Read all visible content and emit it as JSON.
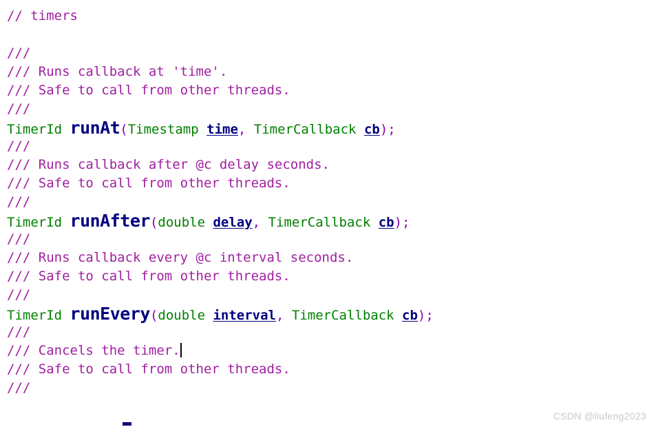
{
  "editor": {
    "language": "cpp",
    "colors": {
      "comment": "#a020a0",
      "type": "#008000",
      "function": "#00007f",
      "punctuation": "#8f00af",
      "parameter": "#00007f",
      "background": "#ffffff",
      "caret": "#000000",
      "watermark": "#c9c9c9"
    },
    "lines": [
      {
        "id": 1,
        "text": "// timers"
      },
      {
        "id": 2,
        "text": ""
      },
      {
        "id": 3,
        "text": "///"
      },
      {
        "id": 4,
        "text": "/// Runs callback at 'time'."
      },
      {
        "id": 5,
        "text": "/// Safe to call from other threads."
      },
      {
        "id": 6,
        "text": "///"
      },
      {
        "id": 7,
        "text": "TimerId runAt(Timestamp time, TimerCallback cb);"
      },
      {
        "id": 8,
        "text": "///"
      },
      {
        "id": 9,
        "text": "/// Runs callback after @c delay seconds."
      },
      {
        "id": 10,
        "text": "/// Safe to call from other threads."
      },
      {
        "id": 11,
        "text": "///"
      },
      {
        "id": 12,
        "text": "TimerId runAfter(double delay, TimerCallback cb);"
      },
      {
        "id": 13,
        "text": "///"
      },
      {
        "id": 14,
        "text": "/// Runs callback every @c interval seconds."
      },
      {
        "id": 15,
        "text": "/// Safe to call from other threads."
      },
      {
        "id": 16,
        "text": "///"
      },
      {
        "id": 17,
        "text": "TimerId runEvery(double interval, TimerCallback cb);"
      },
      {
        "id": 18,
        "text": "///"
      },
      {
        "id": 19,
        "text": "/// Cancels the timer."
      },
      {
        "id": 20,
        "text": "/// Safe to call from other threads."
      },
      {
        "id": 21,
        "text": "///"
      }
    ],
    "tokens": {
      "l1_comment": "// timers",
      "l3_comment": "///",
      "l4_comment": "/// Runs callback at 'time'.",
      "l5_comment": "/// Safe to call from other threads.",
      "l6_comment": "///",
      "l7_type": "TimerId ",
      "l7_func": "runAt",
      "l7_open": "(",
      "l7_argtype1": "Timestamp ",
      "l7_param1": "time",
      "l7_comma": ", ",
      "l7_argtype2": "TimerCallback ",
      "l7_param2": "cb",
      "l7_close": ");",
      "l8_comment": "///",
      "l9_comment": "/// Runs callback after @c delay seconds.",
      "l10_comment": "/// Safe to call from other threads.",
      "l11_comment": "///",
      "l12_type": "TimerId ",
      "l12_func": "runAfter",
      "l12_open": "(",
      "l12_argtype1": "double ",
      "l12_param1": "delay",
      "l12_comma": ", ",
      "l12_argtype2": "TimerCallback ",
      "l12_param2": "cb",
      "l12_close": ");",
      "l13_comment": "///",
      "l14_comment": "/// Runs callback every @c interval seconds.",
      "l15_comment": "/// Safe to call from other threads.",
      "l16_comment": "///",
      "l17_type": "TimerId ",
      "l17_func": "runEvery",
      "l17_open": "(",
      "l17_argtype1": "double ",
      "l17_param1": "interval",
      "l17_comma": ", ",
      "l17_argtype2": "TimerCallback ",
      "l17_param2": "cb",
      "l17_close": ");",
      "l18_comment": "///",
      "l19_comment": "/// Cancels the timer.",
      "l20_comment": "/// Safe to call from other threads.",
      "l21_comment": "///"
    },
    "caret": {
      "line": 19,
      "after_text": "/// Cancels the timer."
    }
  },
  "watermark": {
    "text": "CSDN @liufeng2023"
  }
}
